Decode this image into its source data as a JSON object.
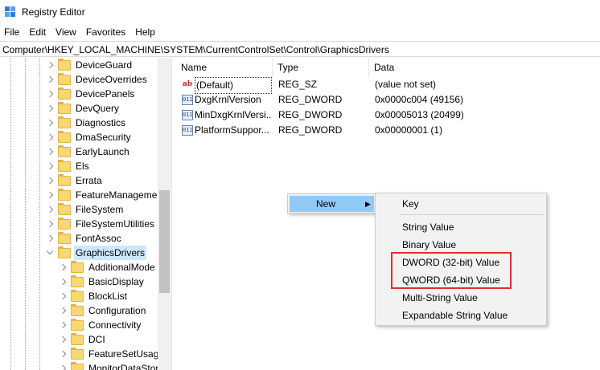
{
  "window": {
    "title": "Registry Editor"
  },
  "menubar": [
    "File",
    "Edit",
    "View",
    "Favorites",
    "Help"
  ],
  "address": "Computer\\HKEY_LOCAL_MACHINE\\SYSTEM\\CurrentControlSet\\Control\\GraphicsDrivers",
  "tree": {
    "items": [
      {
        "label": "DeviceGuard",
        "level": 1,
        "expanded": false
      },
      {
        "label": "DeviceOverrides",
        "level": 1,
        "expanded": false
      },
      {
        "label": "DevicePanels",
        "level": 1,
        "expanded": false
      },
      {
        "label": "DevQuery",
        "level": 1,
        "expanded": false
      },
      {
        "label": "Diagnostics",
        "level": 1,
        "expanded": false
      },
      {
        "label": "DmaSecurity",
        "level": 1,
        "expanded": false
      },
      {
        "label": "EarlyLaunch",
        "level": 1,
        "expanded": false
      },
      {
        "label": "Els",
        "level": 1,
        "expanded": false
      },
      {
        "label": "Errata",
        "level": 1,
        "expanded": false
      },
      {
        "label": "FeatureManagemer",
        "level": 1,
        "expanded": false
      },
      {
        "label": "FileSystem",
        "level": 1,
        "expanded": false
      },
      {
        "label": "FileSystemUtilities",
        "level": 1,
        "expanded": false
      },
      {
        "label": "FontAssoc",
        "level": 1,
        "expanded": false
      },
      {
        "label": "GraphicsDrivers",
        "level": 1,
        "expanded": true,
        "selected": true
      },
      {
        "label": "AdditionalMode",
        "level": 2,
        "expanded": false
      },
      {
        "label": "BasicDisplay",
        "level": 2,
        "expanded": false
      },
      {
        "label": "BlockList",
        "level": 2,
        "expanded": false
      },
      {
        "label": "Configuration",
        "level": 2,
        "expanded": false
      },
      {
        "label": "Connectivity",
        "level": 2,
        "expanded": false
      },
      {
        "label": "DCI",
        "level": 2,
        "expanded": false
      },
      {
        "label": "FeatureSetUsage",
        "level": 2,
        "expanded": false
      },
      {
        "label": "MonitorDataStor",
        "level": 2,
        "expanded": false
      }
    ]
  },
  "list": {
    "columns": [
      "Name",
      "Type",
      "Data"
    ],
    "rows": [
      {
        "name": "(Default)",
        "type": "REG_SZ",
        "data": "(value not set)",
        "icon": "string-value-icon",
        "icon_text": "ab"
      },
      {
        "name": "DxgKrnlVersion",
        "type": "REG_DWORD",
        "data": "0x0000c004 (49156)",
        "icon": "binary-value-icon",
        "icon_text": "011"
      },
      {
        "name": "MinDxgKrnlVersi...",
        "type": "REG_DWORD",
        "data": "0x00005013 (20499)",
        "icon": "binary-value-icon",
        "icon_text": "011"
      },
      {
        "name": "PlatformSuppor...",
        "type": "REG_DWORD",
        "data": "0x00000001 (1)",
        "icon": "binary-value-icon",
        "icon_text": "011"
      }
    ]
  },
  "context_menu": {
    "new_label": "New",
    "arrow": "▶"
  },
  "submenu": {
    "items": [
      "Key",
      "String Value",
      "Binary Value",
      "DWORD (32-bit) Value",
      "QWORD (64-bit) Value",
      "Multi-String Value",
      "Expandable String Value"
    ]
  },
  "colors": {
    "selection": "#cce8ff",
    "menu_hover": "#91c9f7",
    "highlight_box": "#e03030"
  }
}
